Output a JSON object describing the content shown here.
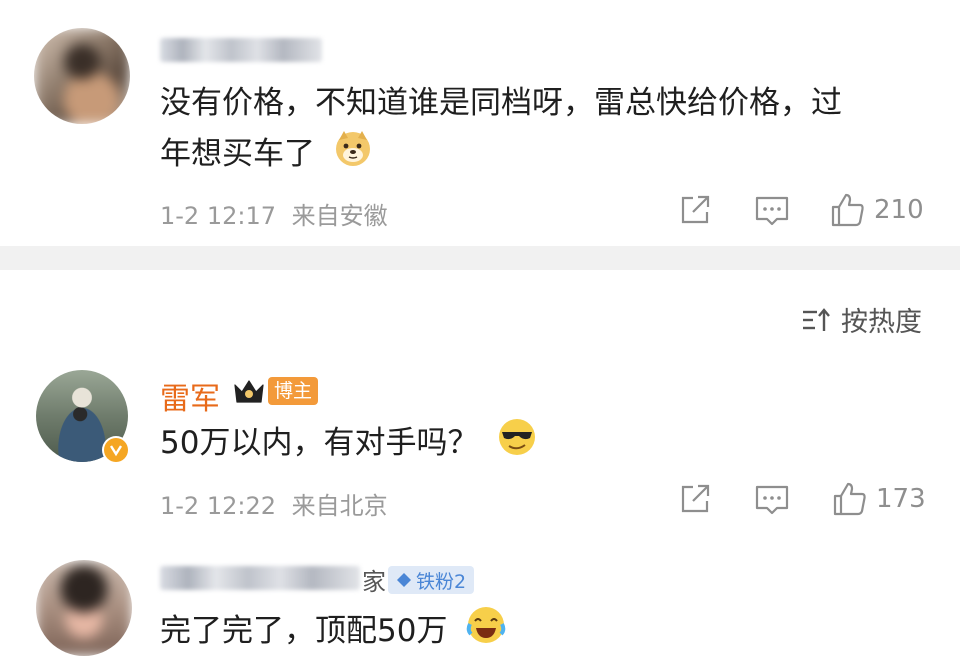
{
  "comments": [
    {
      "username_visible": "",
      "text_line1": "没有价格，不知道谁是同档呀，雷总快给价格，过",
      "text_line2": "年想买车了",
      "emoji": "doge-emoji",
      "time": "1-2 12:17",
      "location": "来自安徽",
      "likes": "210"
    },
    {
      "username": "雷军",
      "badge": "博主",
      "text": "50万以内，有对手吗？",
      "emoji": "sunglasses-emoji",
      "time": "1-2 12:22",
      "location": "来自北京",
      "likes": "173"
    },
    {
      "username_suffix": "家",
      "fan_badge": "铁粉2",
      "text": "完了完了，顶配50万",
      "emoji": "laughing-crying-emoji"
    }
  ],
  "sort": {
    "label": "按热度",
    "icon": "sort-icon"
  },
  "icons": {
    "share": "share-icon",
    "comment": "comment-icon",
    "like": "thumbs-up-icon"
  },
  "colors": {
    "username_accent": "#e86a19",
    "blogger_badge": "#f39a3a",
    "fan_badge_bg": "#dfe9f7",
    "fan_badge_text": "#4a86d6",
    "divider": "#f1f1f1"
  }
}
